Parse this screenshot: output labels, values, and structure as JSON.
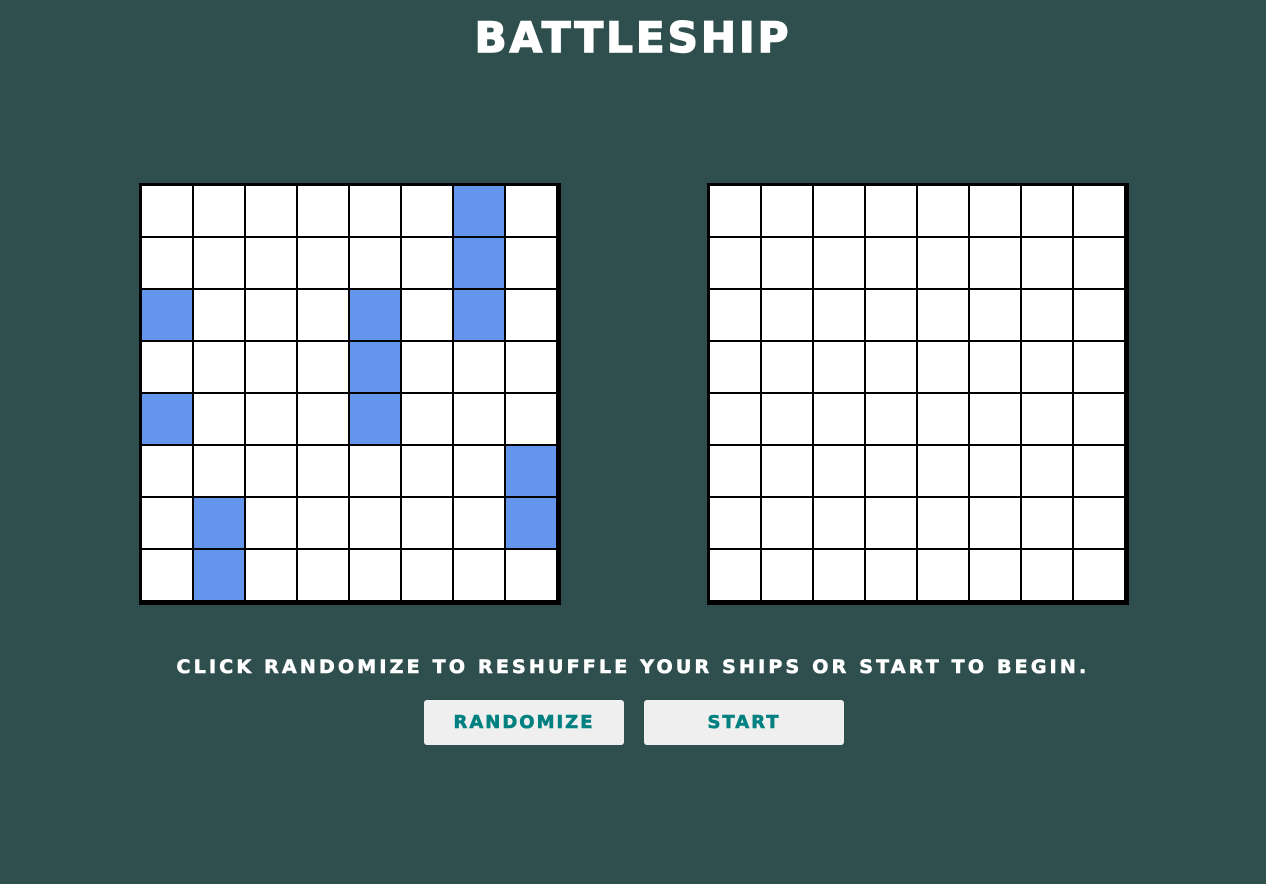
{
  "title": "BATTLESHIP",
  "message": "CLICK RANDOMIZE TO RESHUFFLE YOUR SHIPS OR START TO BEGIN.",
  "buttons": {
    "randomize_label": "RANDOMIZE",
    "start_label": "START"
  },
  "colors": {
    "background": "#2f4f4f",
    "ship": "#6495ed",
    "water": "#ffffff",
    "grid_line": "#000000",
    "button_bg": "#efefef",
    "button_text": "#008080"
  },
  "grid_size": 8,
  "player_board": {
    "rows": [
      [
        0,
        0,
        0,
        0,
        0,
        0,
        1,
        0
      ],
      [
        0,
        0,
        0,
        0,
        0,
        0,
        1,
        0
      ],
      [
        1,
        0,
        0,
        0,
        1,
        0,
        1,
        0
      ],
      [
        0,
        0,
        0,
        0,
        1,
        0,
        0,
        0
      ],
      [
        1,
        0,
        0,
        0,
        1,
        0,
        0,
        0
      ],
      [
        0,
        0,
        0,
        0,
        0,
        0,
        0,
        1
      ],
      [
        0,
        1,
        0,
        0,
        0,
        0,
        0,
        1
      ],
      [
        0,
        1,
        0,
        0,
        0,
        0,
        0,
        0
      ]
    ]
  },
  "opponent_board": {
    "rows": [
      [
        0,
        0,
        0,
        0,
        0,
        0,
        0,
        0
      ],
      [
        0,
        0,
        0,
        0,
        0,
        0,
        0,
        0
      ],
      [
        0,
        0,
        0,
        0,
        0,
        0,
        0,
        0
      ],
      [
        0,
        0,
        0,
        0,
        0,
        0,
        0,
        0
      ],
      [
        0,
        0,
        0,
        0,
        0,
        0,
        0,
        0
      ],
      [
        0,
        0,
        0,
        0,
        0,
        0,
        0,
        0
      ],
      [
        0,
        0,
        0,
        0,
        0,
        0,
        0,
        0
      ],
      [
        0,
        0,
        0,
        0,
        0,
        0,
        0,
        0
      ]
    ]
  }
}
